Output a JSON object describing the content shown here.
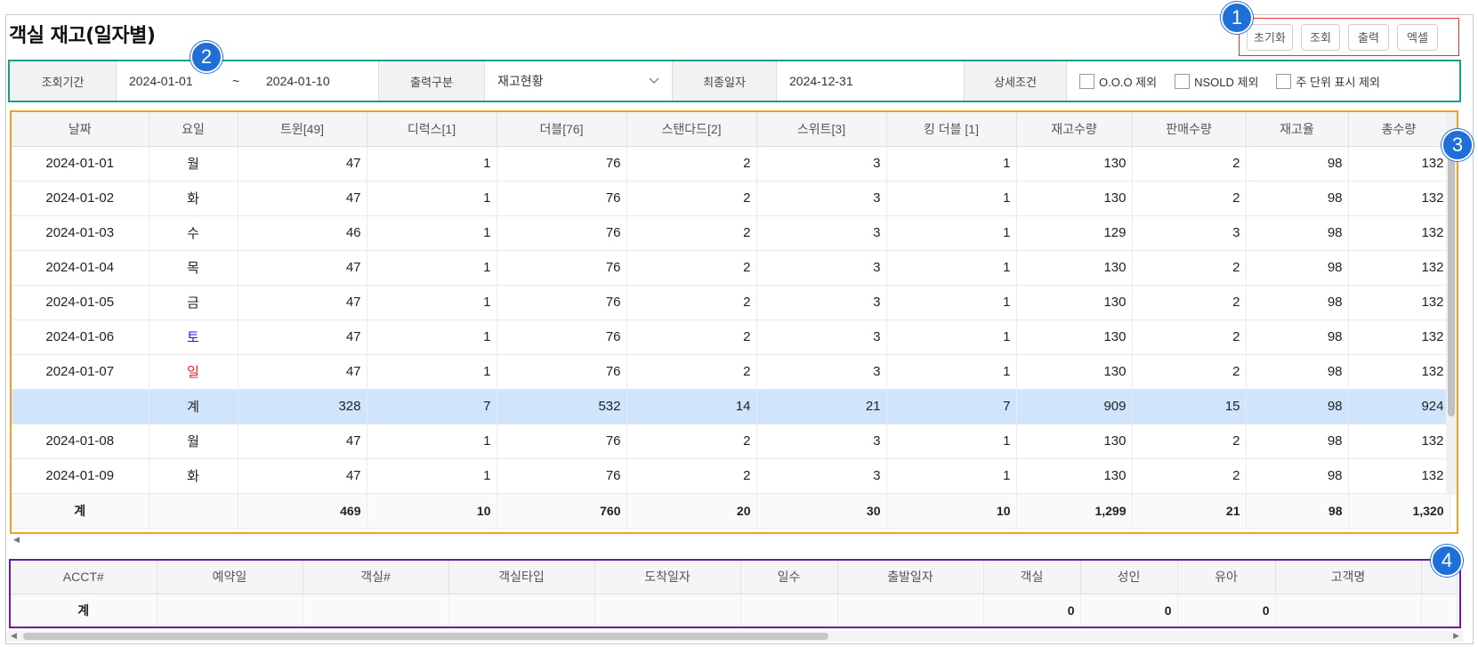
{
  "title": "객실 재고(일자별)",
  "buttons": [
    "초기화",
    "조회",
    "출력",
    "엑셀"
  ],
  "badges": [
    "1",
    "2",
    "3",
    "4"
  ],
  "filter": {
    "period_label": "조회기간",
    "date_from": "2024-01-01",
    "tilde": "~",
    "date_to": "2024-01-10",
    "output_label": "출력구분",
    "output_value": "재고현황",
    "last_date_label": "최종일자",
    "last_date_value": "2024-12-31",
    "detail_label": "상세조건",
    "checkboxes": [
      "O.O.O 제외",
      "NSOLD 제외",
      "주 단위 표시 제외"
    ]
  },
  "inventory": {
    "headers": [
      "날짜",
      "요일",
      "트윈[49]",
      "디럭스[1]",
      "더블[76]",
      "스탠다드[2]",
      "스위트[3]",
      "킹 더블 [1]",
      "재고수량",
      "판매수량",
      "재고율",
      "총수량"
    ],
    "rows": [
      {
        "date": "2024-01-01",
        "day": "월",
        "day_color": "#222222",
        "vals": [
          "47",
          "1",
          "76",
          "2",
          "3",
          "1",
          "130",
          "2",
          "98",
          "132"
        ]
      },
      {
        "date": "2024-01-02",
        "day": "화",
        "day_color": "#222222",
        "vals": [
          "47",
          "1",
          "76",
          "2",
          "3",
          "1",
          "130",
          "2",
          "98",
          "132"
        ]
      },
      {
        "date": "2024-01-03",
        "day": "수",
        "day_color": "#222222",
        "vals": [
          "46",
          "1",
          "76",
          "2",
          "3",
          "1",
          "129",
          "3",
          "98",
          "132"
        ]
      },
      {
        "date": "2024-01-04",
        "day": "목",
        "day_color": "#222222",
        "vals": [
          "47",
          "1",
          "76",
          "2",
          "3",
          "1",
          "130",
          "2",
          "98",
          "132"
        ]
      },
      {
        "date": "2024-01-05",
        "day": "금",
        "day_color": "#222222",
        "vals": [
          "47",
          "1",
          "76",
          "2",
          "3",
          "1",
          "130",
          "2",
          "98",
          "132"
        ]
      },
      {
        "date": "2024-01-06",
        "day": "토",
        "day_color": "#1a1adb",
        "vals": [
          "47",
          "1",
          "76",
          "2",
          "3",
          "1",
          "130",
          "2",
          "98",
          "132"
        ]
      },
      {
        "date": "2024-01-07",
        "day": "일",
        "day_color": "#e52222",
        "vals": [
          "47",
          "1",
          "76",
          "2",
          "3",
          "1",
          "130",
          "2",
          "98",
          "132"
        ]
      },
      {
        "date": "",
        "day": "계",
        "day_color": "#222222",
        "subtotal": true,
        "vals": [
          "328",
          "7",
          "532",
          "14",
          "21",
          "7",
          "909",
          "15",
          "98",
          "924"
        ]
      },
      {
        "date": "2024-01-08",
        "day": "월",
        "day_color": "#222222",
        "vals": [
          "47",
          "1",
          "76",
          "2",
          "3",
          "1",
          "130",
          "2",
          "98",
          "132"
        ]
      },
      {
        "date": "2024-01-09",
        "day": "화",
        "day_color": "#222222",
        "vals": [
          "47",
          "1",
          "76",
          "2",
          "3",
          "1",
          "130",
          "2",
          "98",
          "132"
        ]
      }
    ],
    "footer": {
      "label": "계",
      "vals": [
        "469",
        "10",
        "760",
        "20",
        "30",
        "10",
        "1,299",
        "21",
        "98",
        "1,320"
      ]
    }
  },
  "reservations": {
    "headers": [
      "ACCT#",
      "예약일",
      "객실#",
      "객실타입",
      "도착일자",
      "일수",
      "출발일자",
      "객실",
      "성인",
      "유아",
      "고객명"
    ],
    "footer": {
      "label": "계",
      "vals": [
        "",
        "",
        "",
        "",
        "",
        "",
        "0",
        "0",
        "0",
        ""
      ]
    }
  }
}
